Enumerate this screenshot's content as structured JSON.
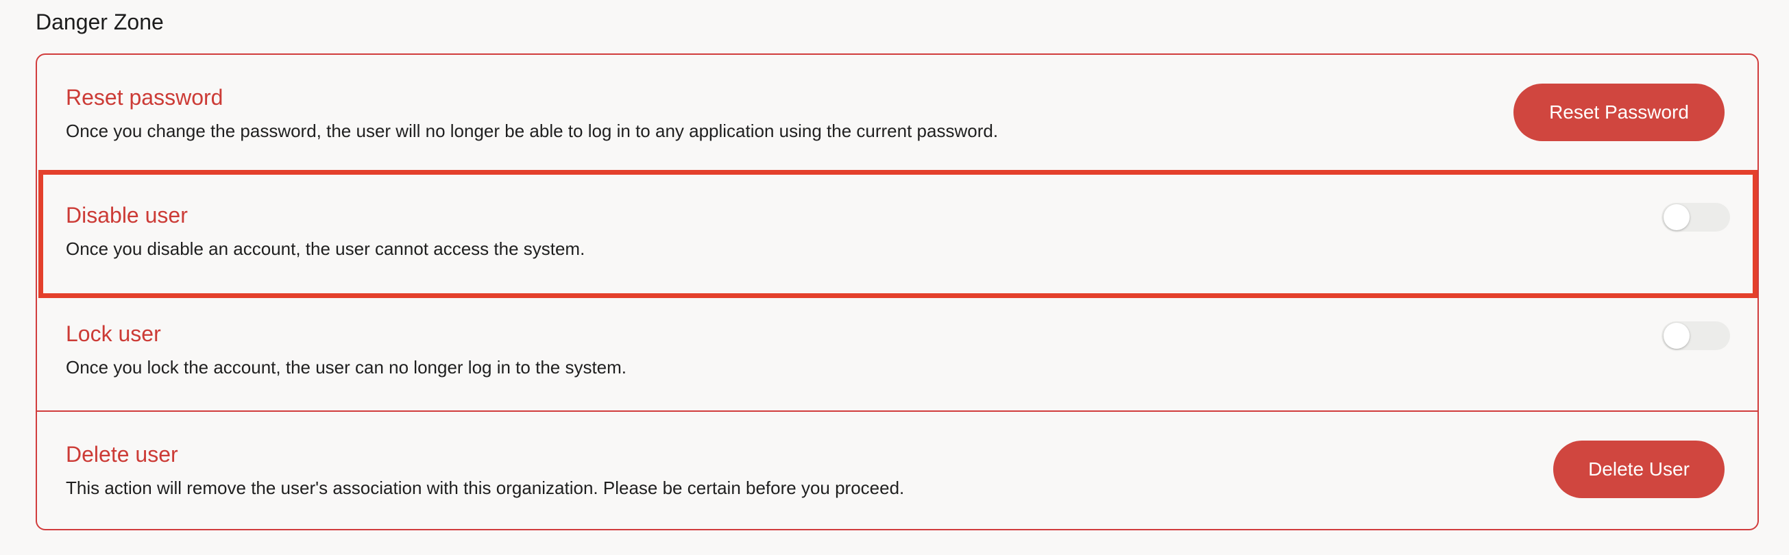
{
  "section": {
    "title": "Danger Zone"
  },
  "rows": [
    {
      "title": "Reset password",
      "description": "Once you change the password, the user will no longer be able to log in to any application using the current password.",
      "action": "button",
      "button_label": "Reset Password"
    },
    {
      "title": "Disable user",
      "description": "Once you disable an account, the user cannot access the system.",
      "action": "toggle",
      "toggle_on": false,
      "highlighted": true
    },
    {
      "title": "Lock user",
      "description": "Once you lock the account, the user can no longer log in to the system.",
      "action": "toggle",
      "toggle_on": false
    },
    {
      "title": "Delete user",
      "description": "This action will remove the user's association with this organization. Please be certain before you proceed.",
      "action": "button",
      "button_label": "Delete User"
    }
  ],
  "colors": {
    "danger": "#cc3b36",
    "button_bg": "#d0463f",
    "border": "#d13c3c",
    "highlight": "#e4402c",
    "background": "#f9f8f7",
    "toggle_off": "#ececea"
  }
}
